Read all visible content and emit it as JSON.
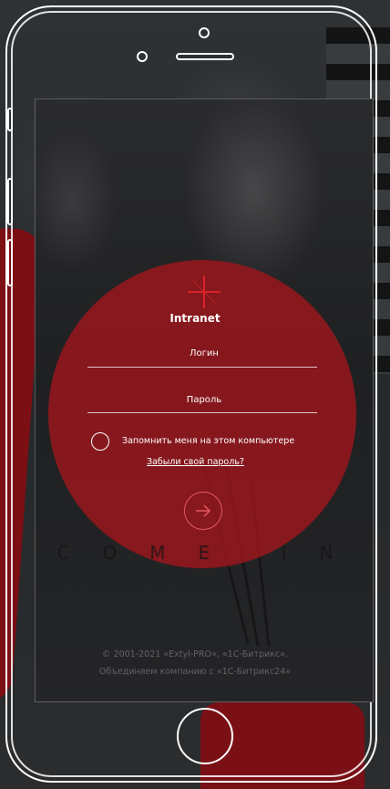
{
  "login_form": {
    "brand": "Intranet",
    "login_placeholder": "Логин",
    "password_placeholder": "Пароль",
    "remember_label": "Запомнить меня на этом компьютере",
    "forgot_link": "Забыли свой пароль?",
    "submit_icon": "arrow-right-icon",
    "tagline": "COME IN"
  },
  "footer": {
    "copyright": "© 2001-2021 «Extyl-PRO», «1С-Битрикс».",
    "slogan": "Объединяем компанию с «1С-Битрикс24»"
  },
  "colors": {
    "accent_red": "#9e161c",
    "logo_red": "#e0252d",
    "text": "#ffffff"
  }
}
